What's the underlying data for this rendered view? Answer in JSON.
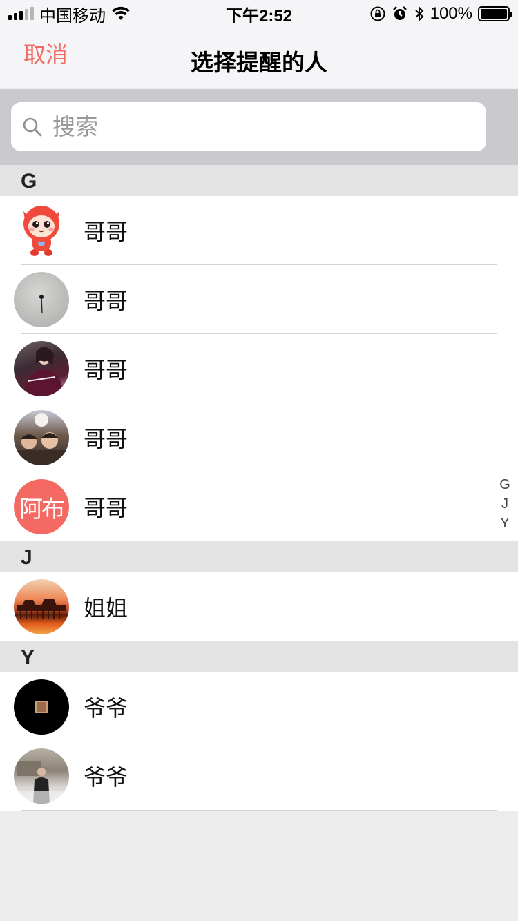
{
  "status_bar": {
    "carrier": "中国移动",
    "time": "下午2:52",
    "battery": "100%"
  },
  "nav": {
    "cancel_label": "取消",
    "title": "选择提醒的人"
  },
  "search": {
    "placeholder": "搜索"
  },
  "sections": [
    {
      "letter": "G",
      "contacts": [
        {
          "name": "哥哥",
          "avatar": "cartoon-avatar"
        },
        {
          "name": "哥哥",
          "avatar": "photo-avatar"
        },
        {
          "name": "哥哥",
          "avatar": "photo-avatar"
        },
        {
          "name": "哥哥",
          "avatar": "photo-avatar"
        },
        {
          "name": "哥哥",
          "avatar": "text-avatar",
          "avatar_text": "阿布"
        }
      ]
    },
    {
      "letter": "J",
      "contacts": [
        {
          "name": "姐姐",
          "avatar": "photo-avatar"
        }
      ]
    },
    {
      "letter": "Y",
      "contacts": [
        {
          "name": "爷爷",
          "avatar": "photo-avatar"
        },
        {
          "name": "爷爷",
          "avatar": "photo-avatar"
        }
      ]
    }
  ],
  "index": [
    "G",
    "J",
    "Y"
  ],
  "colors": {
    "accent": "#f26b63",
    "section_bg": "#e3e3e3",
    "search_bg": "#c9c9ce"
  }
}
